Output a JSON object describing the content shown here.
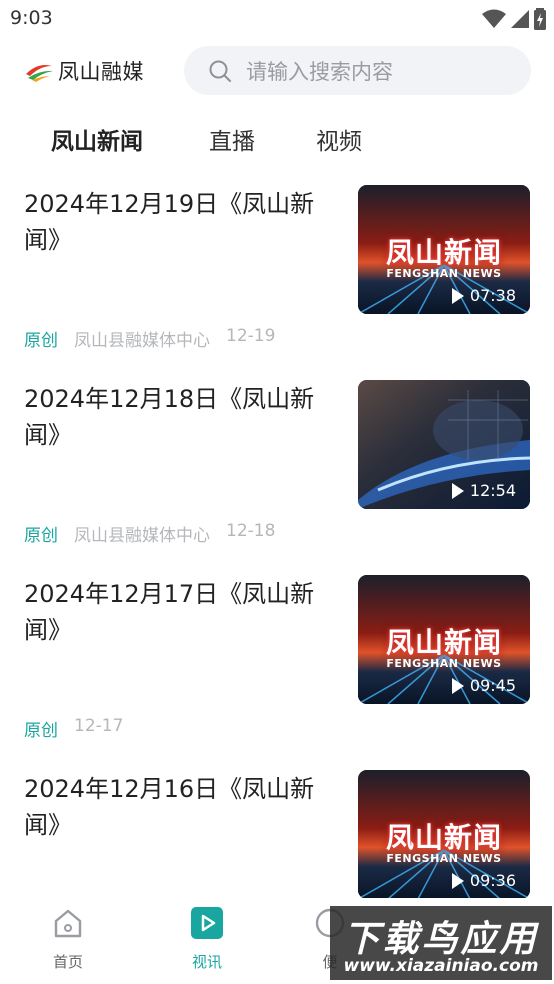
{
  "status_bar": {
    "time": "9:03"
  },
  "header": {
    "app_name": "凤山融媒",
    "search_placeholder": "请输入搜索内容"
  },
  "tabs": [
    {
      "label": "凤山新闻",
      "active": true
    },
    {
      "label": "直播",
      "active": false
    },
    {
      "label": "视频",
      "active": false
    }
  ],
  "feed": [
    {
      "title": "2024年12月19日《凤山新闻》",
      "tag": "原创",
      "source": "凤山县融媒体中心",
      "date": "12-19",
      "duration": "07:38",
      "thumb_title": "凤山新闻",
      "thumb_sub": "FENGSHAN NEWS"
    },
    {
      "title": "2024年12月18日《凤山新闻》",
      "tag": "原创",
      "source": "凤山县融媒体中心",
      "date": "12-18",
      "duration": "12:54",
      "thumb_title": "",
      "thumb_sub": ""
    },
    {
      "title": "2024年12月17日《凤山新闻》",
      "tag": "原创",
      "source": "",
      "date": "12-17",
      "duration": "09:45",
      "thumb_title": "凤山新闻",
      "thumb_sub": "FENGSHAN NEWS"
    },
    {
      "title": "2024年12月16日《凤山新闻》",
      "tag": "",
      "source": "",
      "date": "",
      "duration": "09:36",
      "thumb_title": "凤山新闻",
      "thumb_sub": "FENGSHAN NEWS"
    }
  ],
  "bottom_nav": [
    {
      "label": "首页",
      "icon": "home-icon",
      "active": false
    },
    {
      "label": "视讯",
      "icon": "play-square-icon",
      "active": true
    },
    {
      "label": "便",
      "icon": "service-icon",
      "active": false
    }
  ],
  "watermark": {
    "title": "下载鸟应用",
    "url": "www.xiazainiao.com"
  },
  "colors": {
    "accent": "#1aa6a0",
    "meta_gray": "#b5b7bb",
    "search_bg": "#f2f3f6"
  }
}
